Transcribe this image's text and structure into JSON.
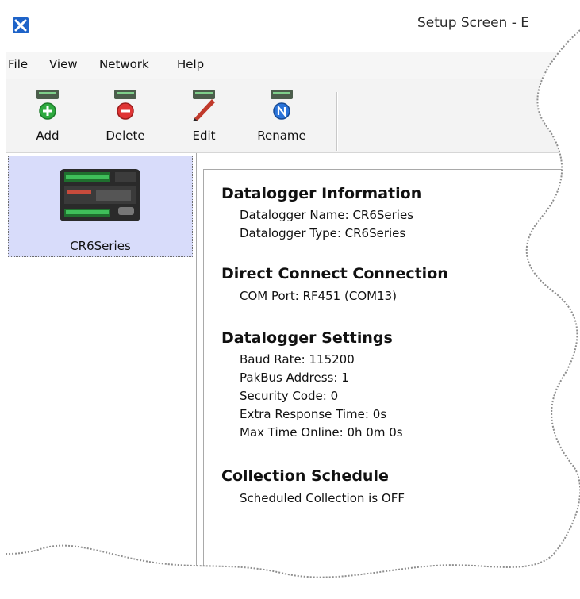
{
  "window": {
    "title": "Setup Screen - E"
  },
  "menu": [
    "File",
    "View",
    "Network",
    "Help"
  ],
  "toolbar": {
    "buttons": [
      {
        "label": "Add",
        "icon": "add-icon"
      },
      {
        "label": "Delete",
        "icon": "delete-icon"
      },
      {
        "label": "Edit",
        "icon": "edit-icon"
      },
      {
        "label": "Rename",
        "icon": "rename-icon"
      }
    ]
  },
  "sidebar": {
    "stations": [
      {
        "label": "CR6Series",
        "icon": "datalogger-image",
        "selected": true
      }
    ]
  },
  "info": {
    "sections": [
      {
        "title": "Datalogger Information",
        "lines": [
          "Datalogger Name: CR6Series",
          "Datalogger Type: CR6Series"
        ]
      },
      {
        "title": "Direct Connect Connection",
        "lines": [
          "COM Port: RF451 (COM13)"
        ]
      },
      {
        "title": "Datalogger Settings",
        "lines": [
          "Baud Rate: 115200",
          "PakBus Address: 1",
          "Security Code: 0",
          "Extra Response Time: 0s",
          "Max Time Online: 0h 0m 0s"
        ]
      },
      {
        "title": "Collection Schedule",
        "lines": [
          "Scheduled Collection is OFF"
        ]
      }
    ]
  },
  "colors": {
    "accent": "#1e63c8",
    "selection": "#d8dcfa",
    "toolbar_bg": "#f3f3f3"
  }
}
